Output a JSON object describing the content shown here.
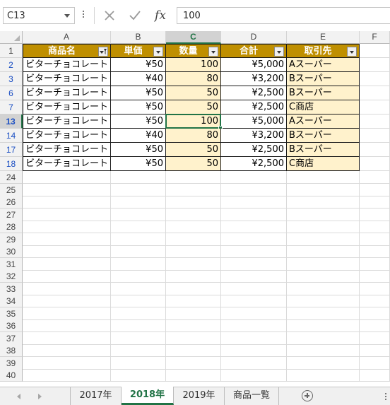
{
  "formula_bar": {
    "name_box": "C13",
    "cancel_icon": "close-icon",
    "enter_icon": "check-icon",
    "function_label": "fx",
    "formula_value": "100"
  },
  "columns": [
    "A",
    "B",
    "C",
    "D",
    "E",
    "F"
  ],
  "selected_column": "C",
  "table_header": [
    "商品名",
    "単価",
    "数量",
    "合計",
    "取引先"
  ],
  "header_row_number": "1",
  "data_rows": [
    {
      "row": "2",
      "product": "ビターチョコレート",
      "price": "¥50",
      "qty": "100",
      "total": "¥5,000",
      "customer": "Aスーパー"
    },
    {
      "row": "3",
      "product": "ビターチョコレート",
      "price": "¥40",
      "qty": "80",
      "total": "¥3,200",
      "customer": "Bスーパー"
    },
    {
      "row": "6",
      "product": "ビターチョコレート",
      "price": "¥50",
      "qty": "50",
      "total": "¥2,500",
      "customer": "Bスーパー"
    },
    {
      "row": "7",
      "product": "ビターチョコレート",
      "price": "¥50",
      "qty": "50",
      "total": "¥2,500",
      "customer": "C商店"
    },
    {
      "row": "13",
      "product": "ビターチョコレート",
      "price": "¥50",
      "qty": "100",
      "total": "¥5,000",
      "customer": "Aスーパー"
    },
    {
      "row": "14",
      "product": "ビターチョコレート",
      "price": "¥40",
      "qty": "80",
      "total": "¥3,200",
      "customer": "Bスーパー"
    },
    {
      "row": "17",
      "product": "ビターチョコレート",
      "price": "¥50",
      "qty": "50",
      "total": "¥2,500",
      "customer": "Bスーパー"
    },
    {
      "row": "18",
      "product": "ビターチョコレート",
      "price": "¥50",
      "qty": "50",
      "total": "¥2,500",
      "customer": "C商店"
    }
  ],
  "selected_row": "13",
  "empty_rows": [
    "24",
    "25",
    "26",
    "27",
    "28",
    "29",
    "30",
    "31",
    "32",
    "33",
    "34",
    "35",
    "36",
    "37",
    "38",
    "39",
    "40"
  ],
  "sheet_tabs": [
    {
      "label": "2017年",
      "active": false
    },
    {
      "label": "2018年",
      "active": true
    },
    {
      "label": "2019年",
      "active": false
    },
    {
      "label": "商品一覧",
      "active": false
    }
  ],
  "colors": {
    "header_fill": "#bf8f00",
    "data_fill": "#fff2cc",
    "accent_green": "#217346",
    "filtered_row_number": "#1a4ec3"
  }
}
